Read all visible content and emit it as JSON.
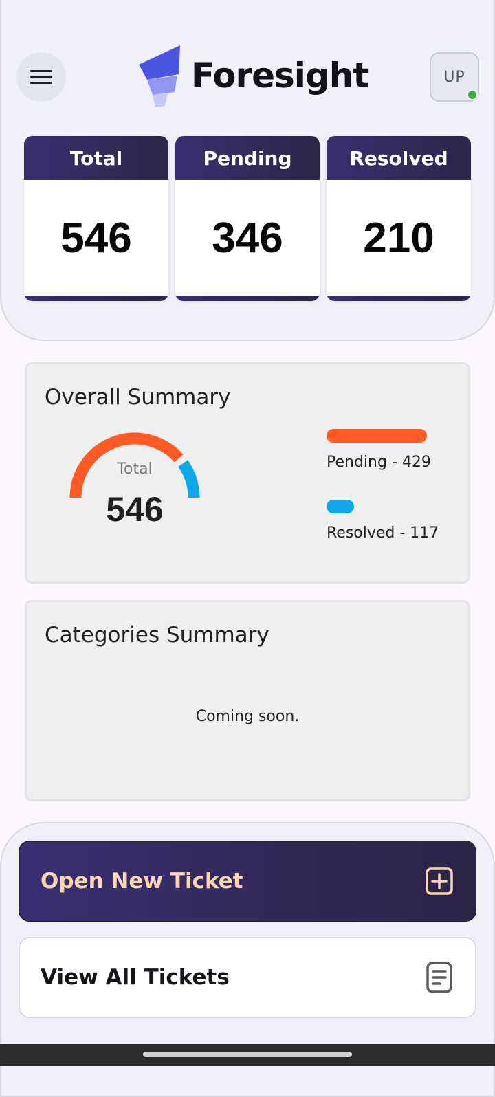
{
  "app": {
    "brand": "Foresight"
  },
  "user": {
    "initials": "UP",
    "online_color": "#3bb54a"
  },
  "stats": [
    {
      "label": "Total",
      "value": "546"
    },
    {
      "label": "Pending",
      "value": "346"
    },
    {
      "label": "Resolved",
      "value": "210"
    }
  ],
  "overall_summary": {
    "title": "Overall Summary",
    "gauge_label": "Total",
    "gauge_value": "546",
    "pending": {
      "label": "Pending - 429",
      "count": 429,
      "color": "#ff5a26"
    },
    "resolved": {
      "label": "Resolved - 117",
      "count": 117,
      "color": "#0ea8e9"
    }
  },
  "categories_summary": {
    "title": "Categories Summary",
    "message": "Coming soon."
  },
  "actions": {
    "open_ticket": "Open New Ticket",
    "view_tickets": "View All Tickets"
  },
  "icons": {
    "menu": "hamburger-menu-icon",
    "logo": "foresight-logo-icon",
    "open_ticket": "plus-square-icon",
    "view_tickets": "document-list-icon"
  },
  "colors": {
    "accent_dark": "#3b2e72",
    "accent_light_text": "#f7d6b4"
  }
}
